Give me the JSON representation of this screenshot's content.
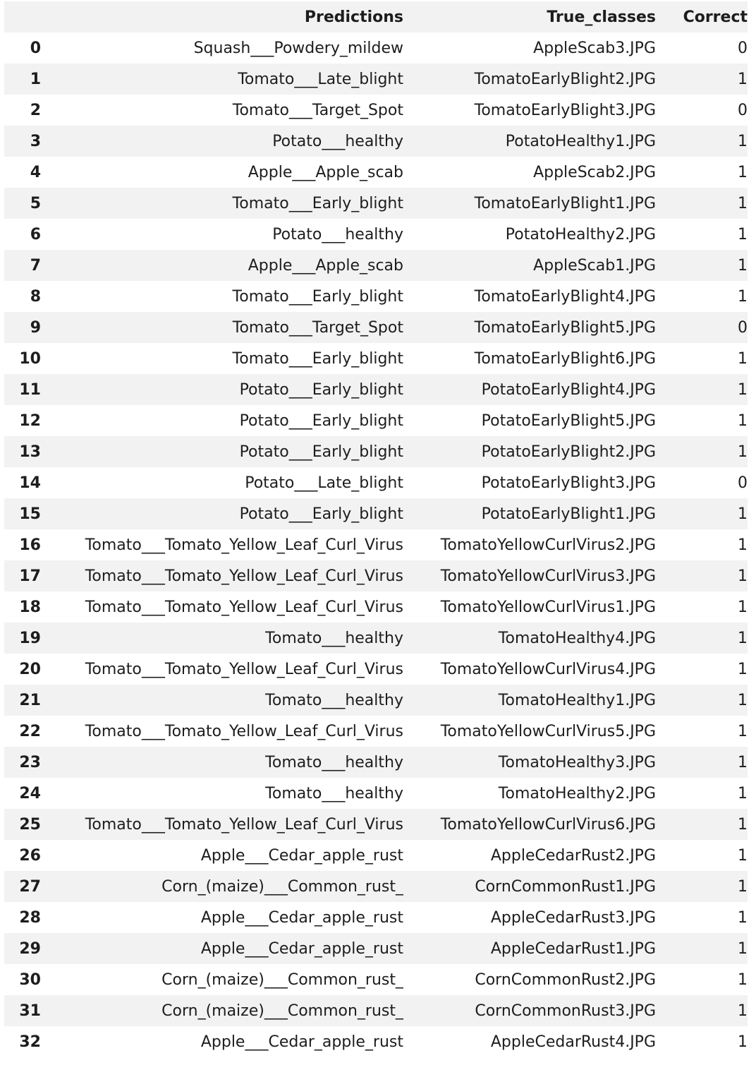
{
  "table": {
    "headers": {
      "index": "",
      "predictions": "Predictions",
      "true_classes": "True_classes",
      "correct": "Correct"
    },
    "rows": [
      {
        "index": "0",
        "prediction": "Squash___Powdery_mildew",
        "true_class": "AppleScab3.JPG",
        "correct": "0"
      },
      {
        "index": "1",
        "prediction": "Tomato___Late_blight",
        "true_class": "TomatoEarlyBlight2.JPG",
        "correct": "1"
      },
      {
        "index": "2",
        "prediction": "Tomato___Target_Spot",
        "true_class": "TomatoEarlyBlight3.JPG",
        "correct": "0"
      },
      {
        "index": "3",
        "prediction": "Potato___healthy",
        "true_class": "PotatoHealthy1.JPG",
        "correct": "1"
      },
      {
        "index": "4",
        "prediction": "Apple___Apple_scab",
        "true_class": "AppleScab2.JPG",
        "correct": "1"
      },
      {
        "index": "5",
        "prediction": "Tomato___Early_blight",
        "true_class": "TomatoEarlyBlight1.JPG",
        "correct": "1"
      },
      {
        "index": "6",
        "prediction": "Potato___healthy",
        "true_class": "PotatoHealthy2.JPG",
        "correct": "1"
      },
      {
        "index": "7",
        "prediction": "Apple___Apple_scab",
        "true_class": "AppleScab1.JPG",
        "correct": "1"
      },
      {
        "index": "8",
        "prediction": "Tomato___Early_blight",
        "true_class": "TomatoEarlyBlight4.JPG",
        "correct": "1"
      },
      {
        "index": "9",
        "prediction": "Tomato___Target_Spot",
        "true_class": "TomatoEarlyBlight5.JPG",
        "correct": "0"
      },
      {
        "index": "10",
        "prediction": "Tomato___Early_blight",
        "true_class": "TomatoEarlyBlight6.JPG",
        "correct": "1"
      },
      {
        "index": "11",
        "prediction": "Potato___Early_blight",
        "true_class": "PotatoEarlyBlight4.JPG",
        "correct": "1"
      },
      {
        "index": "12",
        "prediction": "Potato___Early_blight",
        "true_class": "PotatoEarlyBlight5.JPG",
        "correct": "1"
      },
      {
        "index": "13",
        "prediction": "Potato___Early_blight",
        "true_class": "PotatoEarlyBlight2.JPG",
        "correct": "1"
      },
      {
        "index": "14",
        "prediction": "Potato___Late_blight",
        "true_class": "PotatoEarlyBlight3.JPG",
        "correct": "0"
      },
      {
        "index": "15",
        "prediction": "Potato___Early_blight",
        "true_class": "PotatoEarlyBlight1.JPG",
        "correct": "1"
      },
      {
        "index": "16",
        "prediction": "Tomato___Tomato_Yellow_Leaf_Curl_Virus",
        "true_class": "TomatoYellowCurlVirus2.JPG",
        "correct": "1"
      },
      {
        "index": "17",
        "prediction": "Tomato___Tomato_Yellow_Leaf_Curl_Virus",
        "true_class": "TomatoYellowCurlVirus3.JPG",
        "correct": "1"
      },
      {
        "index": "18",
        "prediction": "Tomato___Tomato_Yellow_Leaf_Curl_Virus",
        "true_class": "TomatoYellowCurlVirus1.JPG",
        "correct": "1"
      },
      {
        "index": "19",
        "prediction": "Tomato___healthy",
        "true_class": "TomatoHealthy4.JPG",
        "correct": "1"
      },
      {
        "index": "20",
        "prediction": "Tomato___Tomato_Yellow_Leaf_Curl_Virus",
        "true_class": "TomatoYellowCurlVirus4.JPG",
        "correct": "1"
      },
      {
        "index": "21",
        "prediction": "Tomato___healthy",
        "true_class": "TomatoHealthy1.JPG",
        "correct": "1"
      },
      {
        "index": "22",
        "prediction": "Tomato___Tomato_Yellow_Leaf_Curl_Virus",
        "true_class": "TomatoYellowCurlVirus5.JPG",
        "correct": "1"
      },
      {
        "index": "23",
        "prediction": "Tomato___healthy",
        "true_class": "TomatoHealthy3.JPG",
        "correct": "1"
      },
      {
        "index": "24",
        "prediction": "Tomato___healthy",
        "true_class": "TomatoHealthy2.JPG",
        "correct": "1"
      },
      {
        "index": "25",
        "prediction": "Tomato___Tomato_Yellow_Leaf_Curl_Virus",
        "true_class": "TomatoYellowCurlVirus6.JPG",
        "correct": "1"
      },
      {
        "index": "26",
        "prediction": "Apple___Cedar_apple_rust",
        "true_class": "AppleCedarRust2.JPG",
        "correct": "1"
      },
      {
        "index": "27",
        "prediction": "Corn_(maize)___Common_rust_",
        "true_class": "CornCommonRust1.JPG",
        "correct": "1"
      },
      {
        "index": "28",
        "prediction": "Apple___Cedar_apple_rust",
        "true_class": "AppleCedarRust3.JPG",
        "correct": "1"
      },
      {
        "index": "29",
        "prediction": "Apple___Cedar_apple_rust",
        "true_class": "AppleCedarRust1.JPG",
        "correct": "1"
      },
      {
        "index": "30",
        "prediction": "Corn_(maize)___Common_rust_",
        "true_class": "CornCommonRust2.JPG",
        "correct": "1"
      },
      {
        "index": "31",
        "prediction": "Corn_(maize)___Common_rust_",
        "true_class": "CornCommonRust3.JPG",
        "correct": "1"
      },
      {
        "index": "32",
        "prediction": "Apple___Cedar_apple_rust",
        "true_class": "AppleCedarRust4.JPG",
        "correct": "1"
      }
    ]
  }
}
